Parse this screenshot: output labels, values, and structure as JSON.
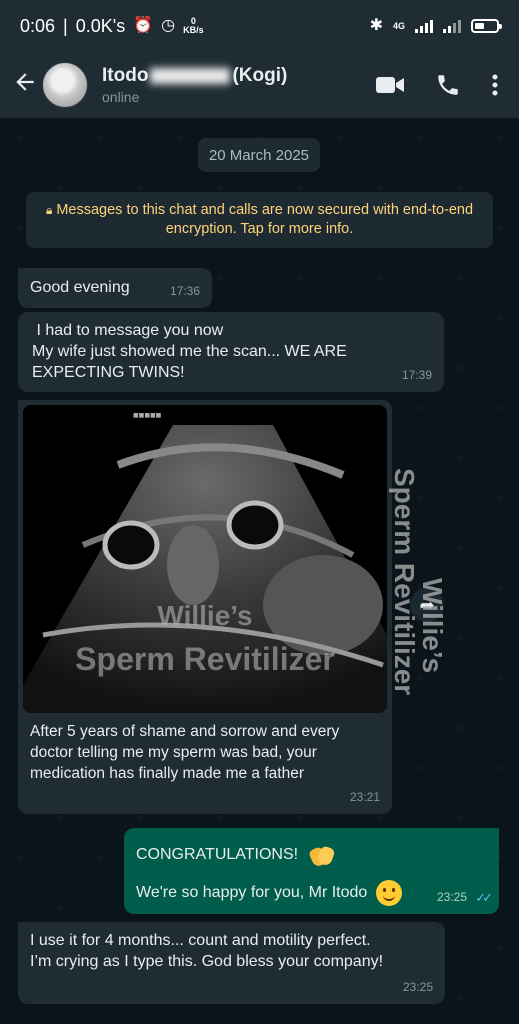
{
  "statusbar": {
    "time": "0:06",
    "speed": "0.0K's",
    "kb_value": "0",
    "kb_unit": "KB/s",
    "network": "4G"
  },
  "header": {
    "name_part1": "Itodo",
    "name_part2": "(Kogi)",
    "status": "online",
    "icons": [
      "back-arrow-icon",
      "video-call-icon",
      "phone-icon",
      "more-vert-icon"
    ]
  },
  "chat": {
    "date_chip": "20 March 2025",
    "encryption_notice": "Messages to this chat and calls are now secured with end-to-end encryption. Tap for more info.",
    "messages": [
      {
        "direction": "in",
        "text": "Good evening",
        "time": "17:36"
      },
      {
        "direction": "in",
        "line1": "I had to message you now",
        "line2": "My wife just showed me the scan... WE ARE EXPECTING TWINS!",
        "time": "17:39"
      },
      {
        "direction": "in",
        "type": "image",
        "image_watermark1": "Willie’s",
        "image_watermark2": "Sperm Revitilizer",
        "caption": "After 5 years of shame and sorrow and every doctor telling me my sperm was bad, your medication has finally made me a father",
        "time": "23:21"
      },
      {
        "direction": "out",
        "line1": "CONGRATULATIONS!",
        "line2": "We're so happy for you, Mr Itodo",
        "time": "23:25"
      },
      {
        "direction": "in",
        "line1": "I use it for 4 months... count and motility perfect.",
        "line2": "I’m crying as I type this. God bless your company!",
        "time": "23:25"
      }
    ],
    "side_watermark1": "Willie’s",
    "side_watermark2": "Sperm Revitilizer"
  }
}
